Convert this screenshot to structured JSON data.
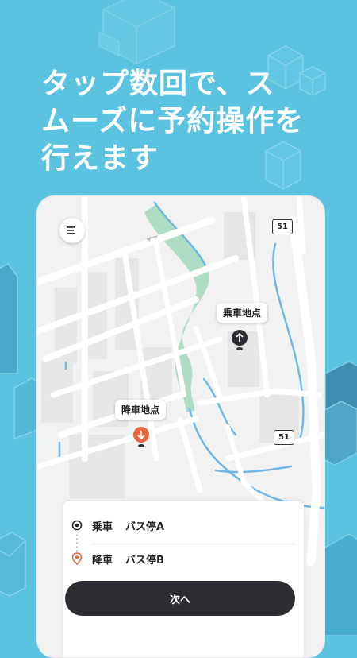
{
  "headline": {
    "line1": "タップ数回で、ス",
    "line2": "ムーズに予約操作を",
    "line3": "行えます"
  },
  "map": {
    "route_numbers": [
      "51",
      "51"
    ],
    "boarding_label": "乗車地点",
    "alighting_label": "降車地点"
  },
  "panel": {
    "boarding": {
      "kind": "乗車",
      "stop": "バス停A",
      "icon": "radio-dot-icon"
    },
    "alighting": {
      "kind": "降車",
      "stop": "バス停B",
      "icon": "location-pin-icon"
    },
    "next_button": "次へ"
  },
  "colors": {
    "background": "#5bc2df",
    "accent_orange": "#e8643c",
    "button_dark": "#2b2d33",
    "river_green": "#aedcc4",
    "water_blue": "#6fb7e5"
  }
}
